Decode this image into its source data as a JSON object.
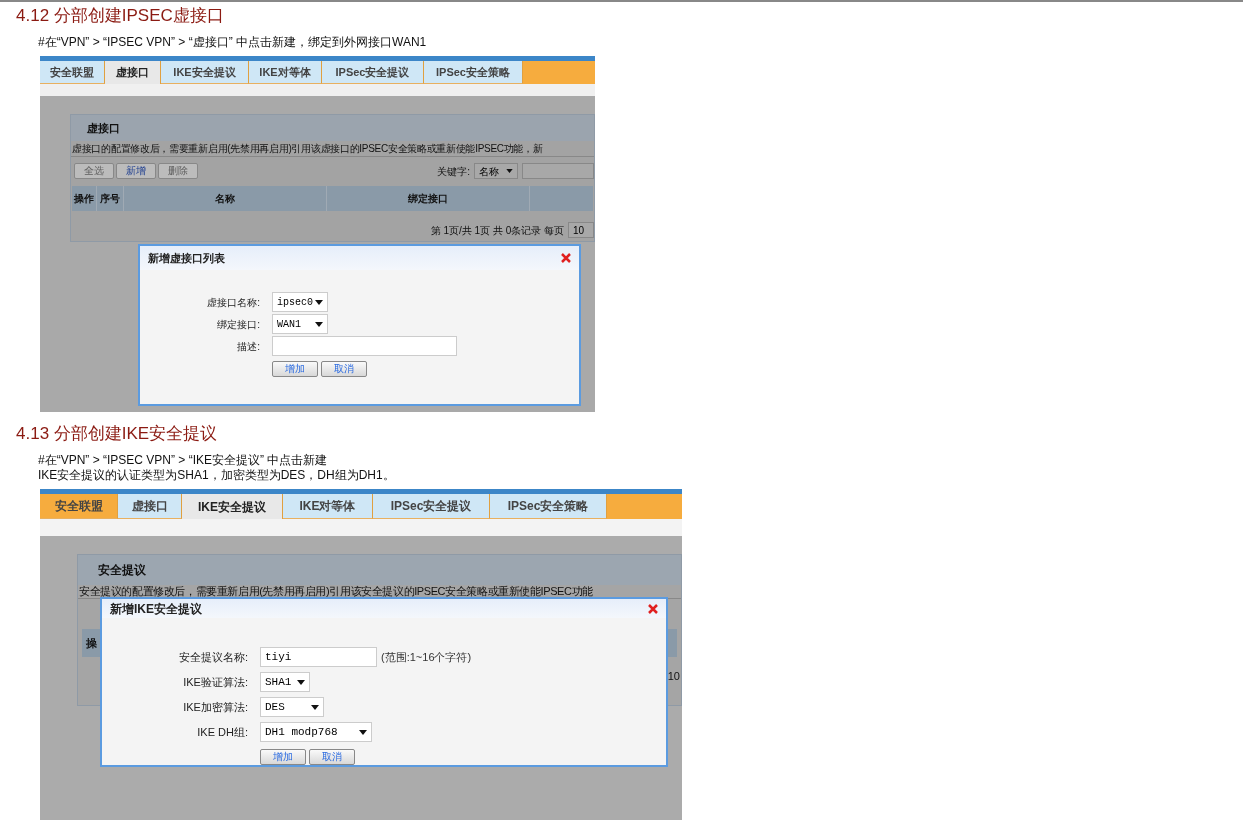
{
  "sections": [
    {
      "heading": "4.12  分部创建IPSEC虚接口",
      "notes": [
        "#在“VPN” > “IPSEC VPN” > “虚接口” 中点击新建，绑定到外网接口WAN1"
      ],
      "screenshot": {
        "tabs": [
          {
            "label": "安全联盟",
            "selected": false,
            "hover": false
          },
          {
            "label": "虚接口",
            "selected": true,
            "hover": false
          },
          {
            "label": "IKE安全提议",
            "selected": false,
            "hover": false
          },
          {
            "label": "IKE对等体",
            "selected": false,
            "hover": false
          },
          {
            "label": "IPSec安全提议",
            "selected": false,
            "hover": false
          },
          {
            "label": "IPSec安全策略",
            "selected": false,
            "hover": false
          }
        ],
        "panel": {
          "title": "虚接口",
          "notice": "虚接口的配置修改后，需要重新启用(先禁用再启用)引用该虚接口的IPSEC安全策略或重新使能IPSEC功能，新",
          "toolbar_buttons": [
            {
              "label": "全选",
              "disabled": true
            },
            {
              "label": "新增",
              "disabled": false
            },
            {
              "label": "删除",
              "disabled": true
            }
          ],
          "keyword_label": "关键字:",
          "keyword_select": "名称",
          "columns": [
            "操作",
            "序号",
            "名称",
            "绑定接口"
          ],
          "pager": "第 1页/共 1页 共 0条记录 每页",
          "page_size": "10"
        },
        "dialog": {
          "title": "新增虚接口列表",
          "fields": [
            {
              "label": "虚接口名称:",
              "kind": "select",
              "value": "ipsec0"
            },
            {
              "label": "绑定接口:",
              "kind": "select",
              "value": "WAN1"
            },
            {
              "label": "描述:",
              "kind": "text"
            }
          ],
          "buttons": [
            "增加",
            "取消"
          ]
        }
      }
    },
    {
      "heading": "4.13  分部创建IKE安全提议",
      "notes": [
        "#在“VPN” > “IPSEC VPN” > “IKE安全提议” 中点击新建",
        "IKE安全提议的认证类型为SHA1，加密类型为DES，DH组为DH1。"
      ],
      "screenshot": {
        "tabs": [
          {
            "label": "安全联盟",
            "selected": false,
            "hover": true
          },
          {
            "label": "虚接口",
            "selected": false,
            "hover": false
          },
          {
            "label": "IKE安全提议",
            "selected": true,
            "hover": false
          },
          {
            "label": "IKE对等体",
            "selected": false,
            "hover": false
          },
          {
            "label": "IPSec安全提议",
            "selected": false,
            "hover": false
          },
          {
            "label": "IPSec安全策略",
            "selected": false,
            "hover": false
          }
        ],
        "panel": {
          "title": "安全提议",
          "notice": "安全提议的配置修改后，需要重新启用(先禁用再启用)引用该安全提议的IPSEC安全策略或重新使能IPSEC功能",
          "column_1": "操",
          "page_size": "10"
        },
        "dialog": {
          "title": "新增IKE安全提议",
          "fields": [
            {
              "label": "安全提议名称:",
              "kind": "text",
              "value": "tiyi",
              "hint": "(范围:1~16个字符)"
            },
            {
              "label": "IKE验证算法:",
              "kind": "select",
              "value": "SHA1"
            },
            {
              "label": "IKE加密算法:",
              "kind": "select",
              "value": "DES"
            },
            {
              "label": "IKE DH组:",
              "kind": "select",
              "value": "DH1 modp768"
            }
          ],
          "buttons": [
            "增加",
            "取消"
          ]
        }
      }
    }
  ]
}
